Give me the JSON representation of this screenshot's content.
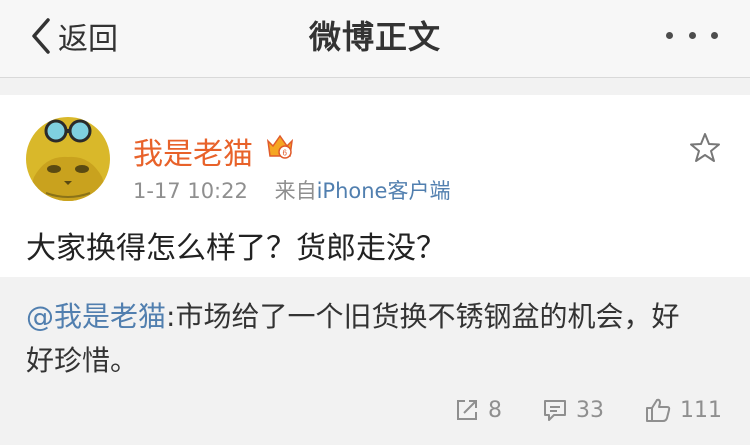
{
  "nav": {
    "back_label": "返回",
    "title": "微博正文"
  },
  "post": {
    "username": "我是老猫",
    "time": "1-17 10:22",
    "source_prefix": "来自",
    "source": "iPhone客户端",
    "text": "大家换得怎么样了？货郎走没？"
  },
  "retweet": {
    "mention": "@我是老猫",
    "text": ":市场给了一个旧货换不锈钢盆的机会，好好珍惜。",
    "actions": {
      "reposts": "8",
      "comments": "33",
      "likes": "111"
    }
  },
  "colors": {
    "username": "#e8622a",
    "link": "#517faf",
    "muted": "#8f8f8f"
  }
}
